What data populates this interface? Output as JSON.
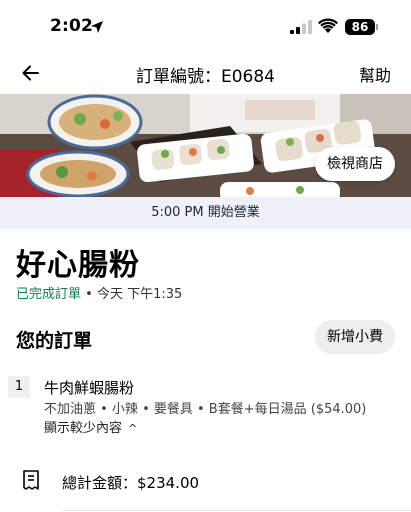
{
  "status_bar": {
    "time": "2:02",
    "battery": "86"
  },
  "nav": {
    "title": "訂單編號：E0684",
    "help_label": "幫助"
  },
  "hero": {
    "view_store_label": "檢視商店"
  },
  "banner": {
    "opening_text": "5:00 PM 開始營業"
  },
  "store": {
    "name": "好心腸粉",
    "status_label": "已完成訂單",
    "status_time": " • 今天 下午1:35"
  },
  "order": {
    "heading": "您的訂單",
    "tip_label": "新增小費",
    "items": [
      {
        "qty": "1",
        "name": "牛肉鮮蝦腸粉",
        "options": "不加油蔥 • 小辣 • 要餐具 • B套餐+每日湯品 ($54.00)",
        "toggle_label": "顯示較少內容"
      }
    ],
    "total": "總計金額：$234.00"
  },
  "icons": {
    "back": "arrow-left-icon",
    "location": "location-arrow-icon",
    "signal": "cellular-signal-icon",
    "wifi": "wifi-icon",
    "receipt": "receipt-icon",
    "chevron": "chevron-up-icon"
  },
  "colors": {
    "completed": "#06834e",
    "banner_bg": "#eef1f8"
  }
}
